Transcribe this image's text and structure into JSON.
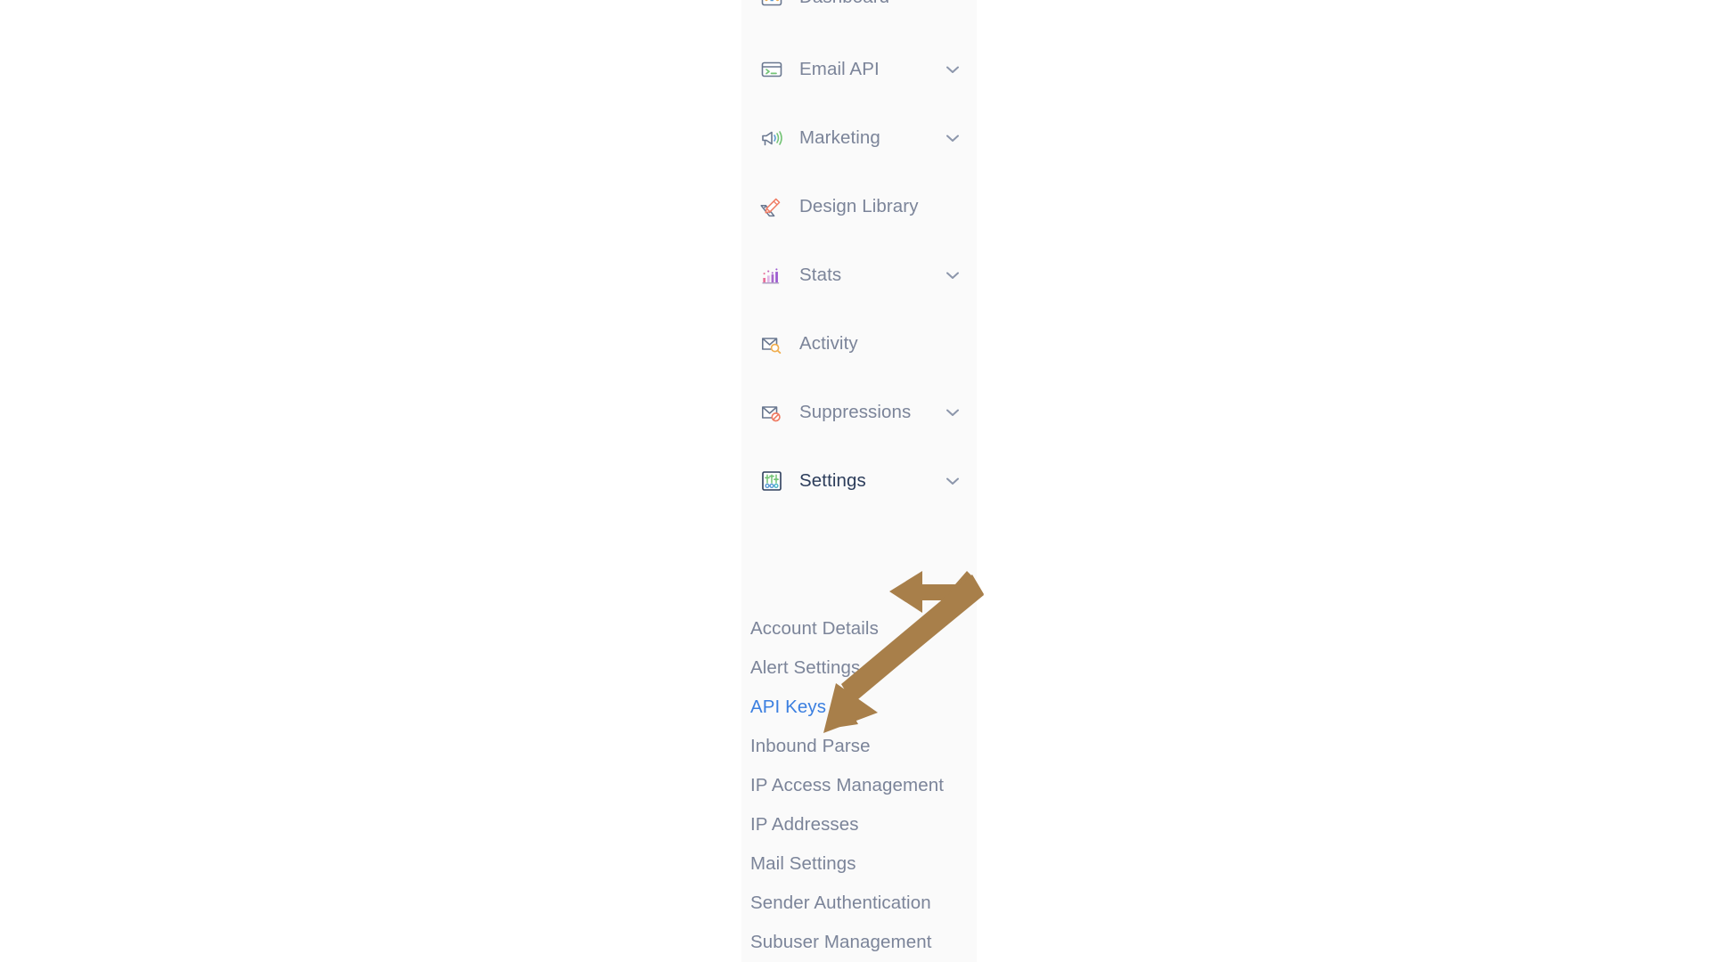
{
  "colors": {
    "page_background": "#ffffff",
    "sidebar_background": "#fafafa",
    "label_text": "#7b8499",
    "label_text_dark": "#2c3d5b",
    "active_link": "#3b7fe0",
    "annotation_arrow": "#a87f4a",
    "icon_outline": "#69778f",
    "icon_green": "#74c476",
    "icon_blue": "#5b9bd5",
    "icon_salmon": "#ef7b63",
    "icon_orange": "#f0ae4e",
    "icon_purple": "#9b59d0",
    "icon_pink": "#e8709a"
  },
  "sidebar": {
    "items": [
      {
        "id": "dashboard",
        "label": "Dashboard",
        "icon": "dashboard-icon",
        "expandable": false,
        "state": "clipped"
      },
      {
        "id": "email-api",
        "label": "Email API",
        "icon": "terminal-icon",
        "expandable": true,
        "state": "collapsed"
      },
      {
        "id": "marketing",
        "label": "Marketing",
        "icon": "megaphone-icon",
        "expandable": true,
        "state": "collapsed"
      },
      {
        "id": "design-library",
        "label": "Design Library",
        "icon": "pencil-ruler-icon",
        "expandable": false,
        "state": "default"
      },
      {
        "id": "stats",
        "label": "Stats",
        "icon": "bar-chart-icon",
        "expandable": true,
        "state": "collapsed"
      },
      {
        "id": "activity",
        "label": "Activity",
        "icon": "envelope-search-icon",
        "expandable": false,
        "state": "default"
      },
      {
        "id": "suppressions",
        "label": "Suppressions",
        "icon": "envelope-blocked-icon",
        "expandable": true,
        "state": "collapsed"
      },
      {
        "id": "settings",
        "label": "Settings",
        "icon": "sliders-icon",
        "expandable": true,
        "state": "expanded"
      }
    ],
    "settings_subitems": [
      {
        "id": "account-details",
        "label": "Account Details",
        "active": false
      },
      {
        "id": "alert-settings",
        "label": "Alert Settings",
        "active": false
      },
      {
        "id": "api-keys",
        "label": "API Keys",
        "active": true
      },
      {
        "id": "inbound-parse",
        "label": "Inbound Parse",
        "active": false
      },
      {
        "id": "ip-access-management",
        "label": "IP Access Management",
        "active": false
      },
      {
        "id": "ip-addresses",
        "label": "IP Addresses",
        "active": false
      },
      {
        "id": "mail-settings",
        "label": "Mail Settings",
        "active": false
      },
      {
        "id": "sender-authentication",
        "label": "Sender Authentication",
        "active": false
      },
      {
        "id": "subuser-management",
        "label": "Subuser Management",
        "active": false
      }
    ]
  },
  "annotation": {
    "type": "double-headed-bent-arrow",
    "color": "#a87f4a",
    "points_to": [
      "Settings",
      "API Keys"
    ]
  }
}
